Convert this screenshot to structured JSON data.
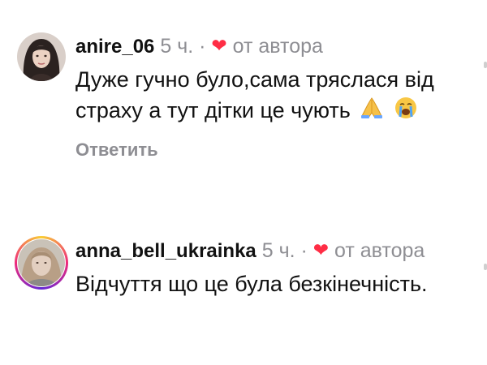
{
  "comments": [
    {
      "username": "anire_06",
      "time": "5 ч.",
      "separator": "·",
      "heart": "❤",
      "by_author": "от автора",
      "text": "Дуже гучно було,сама тряслася від страху а тут дітки це чують",
      "emojis": [
        "folded-hands-icon",
        "loudly-crying-face-icon"
      ],
      "reply_label": "Ответить"
    },
    {
      "username": "anna_bell_ukrainka",
      "time": "5 ч.",
      "separator": "·",
      "heart": "❤",
      "by_author": "от автора",
      "text": "Відчуття що це була безкінечність."
    }
  ],
  "colors": {
    "heart": "#ff2d45",
    "secondary_text": "#8e8e93",
    "primary_text": "#111111"
  }
}
